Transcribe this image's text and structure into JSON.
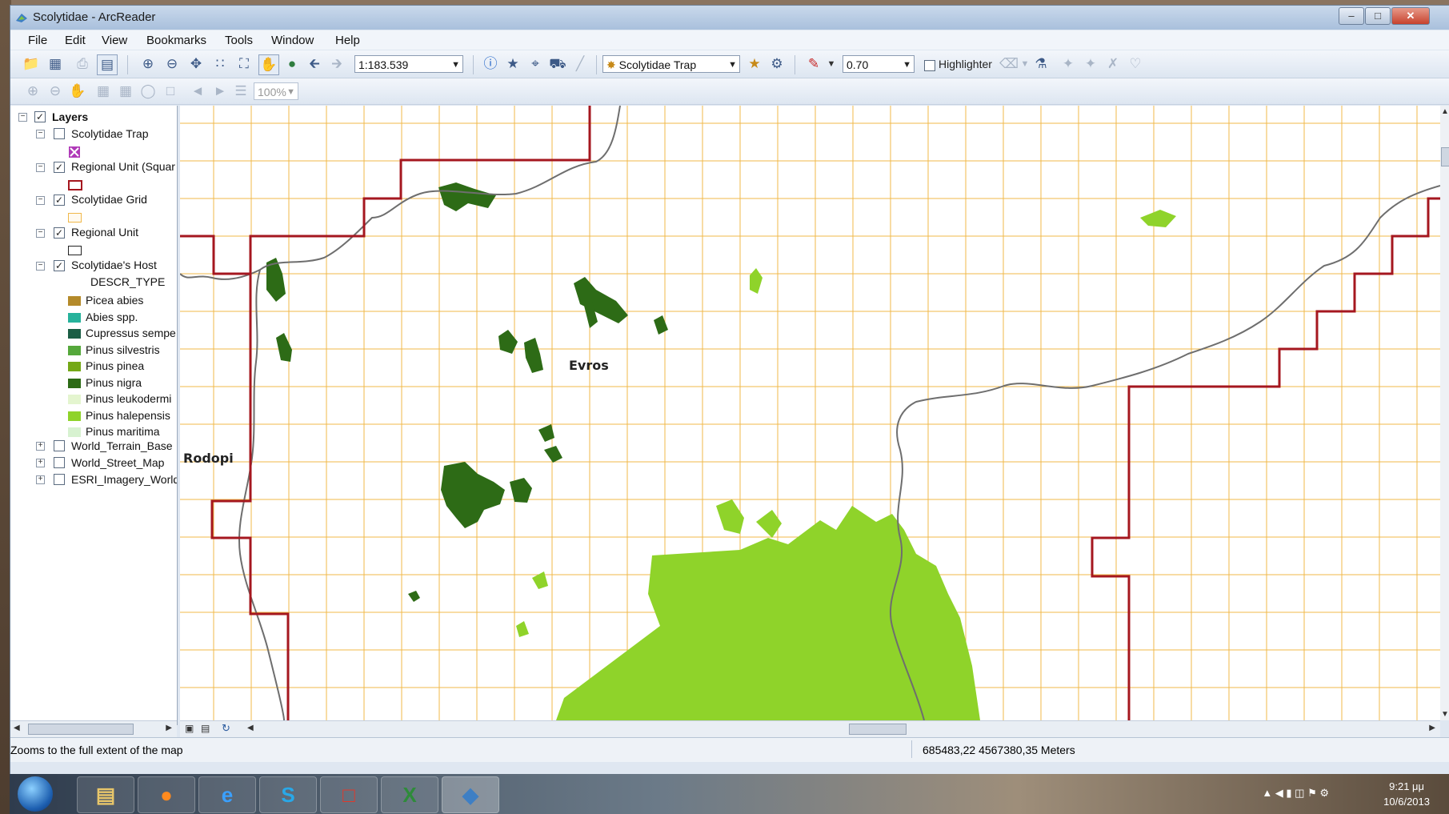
{
  "window": {
    "title": "Scolytidae - ArcReader"
  },
  "menu": [
    "File",
    "Edit",
    "View",
    "Bookmarks",
    "Tools",
    "Window",
    "Help"
  ],
  "toolbar": {
    "scale_value": "1:183.539",
    "active_layer": "Scolytidae Trap",
    "transparency_value": "0.70",
    "highlighter_label": "Highlighter",
    "zoom_percent": "100%"
  },
  "toc": {
    "root": "Layers",
    "layers": [
      {
        "name": "Scolytidae Trap",
        "checked": false,
        "expanded": true,
        "symbol": "trap-symbol-icon"
      },
      {
        "name": "Regional Unit (Squar",
        "checked": true,
        "expanded": true,
        "symbol": "red-outline-square"
      },
      {
        "name": "Scolytidae Grid",
        "checked": true,
        "expanded": true,
        "symbol": "orange-outline-square"
      },
      {
        "name": "Regional Unit",
        "checked": true,
        "expanded": true,
        "symbol": "black-outline-square"
      },
      {
        "name": "Scolytidae's Host",
        "checked": true,
        "expanded": true,
        "field": "DESCR_TYPE"
      }
    ],
    "legend": [
      {
        "label": "Picea abies",
        "color": "#b48a2a"
      },
      {
        "label": "Abies spp.",
        "color": "#26b29b"
      },
      {
        "label": "Cupressus sempe",
        "color": "#1b5e45"
      },
      {
        "label": "Pinus silvestris",
        "color": "#55a83b"
      },
      {
        "label": "Pinus pinea",
        "color": "#74a816"
      },
      {
        "label": "Pinus nigra",
        "color": "#2d6b16"
      },
      {
        "label": "Pinus leukodermi",
        "color": "#e4f5cf"
      },
      {
        "label": "Pinus halepensis",
        "color": "#8fd32a"
      },
      {
        "label": "Pinus maritima",
        "color": "#d7f2d0"
      }
    ],
    "basemaps": [
      {
        "name": "World_Terrain_Base",
        "checked": false
      },
      {
        "name": "World_Street_Map",
        "checked": false
      },
      {
        "name": "ESRI_Imagery_World_",
        "checked": false
      }
    ]
  },
  "map": {
    "labels": {
      "evros": "Evros",
      "rodopi": "Rodopi"
    },
    "colors": {
      "grid": "#f0b84a",
      "region": "#a5171f",
      "river": "#6e6e6e",
      "pine_halepensis": "#8fd32a",
      "pine_nigra": "#2d6b16"
    }
  },
  "status": {
    "message": "Zooms to the full extent of the map",
    "coordinates": "685483,22  4567380,35 Meters"
  },
  "taskbar": {
    "time": "9:21 μμ",
    "date": "10/6/2013",
    "apps": [
      "start-orb-icon",
      "explorer-icon",
      "firefox-icon",
      "internet-explorer-icon",
      "skype-icon",
      "acrobat-icon",
      "excel-icon",
      "arcreader-icon"
    ]
  }
}
